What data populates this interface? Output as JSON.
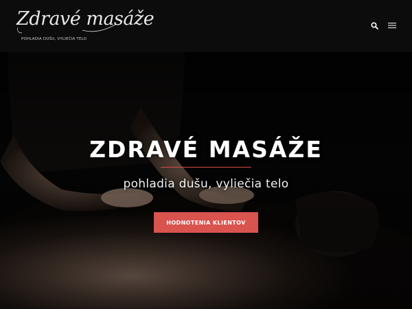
{
  "header": {
    "logo_text": "Zdravé masáže",
    "logo_tagline": "POHLADIA DUŠU, VYLIEČIA TELO",
    "search_icon": "search-icon",
    "menu_icon": "hamburger-menu-icon"
  },
  "hero": {
    "title": "ZDRAVÉ MASÁŽE",
    "subtitle": "pohladia dušu, vyliečia telo",
    "cta_label": "HODNOTENIA KLIENTOV",
    "accent_color": "#d9534f"
  }
}
